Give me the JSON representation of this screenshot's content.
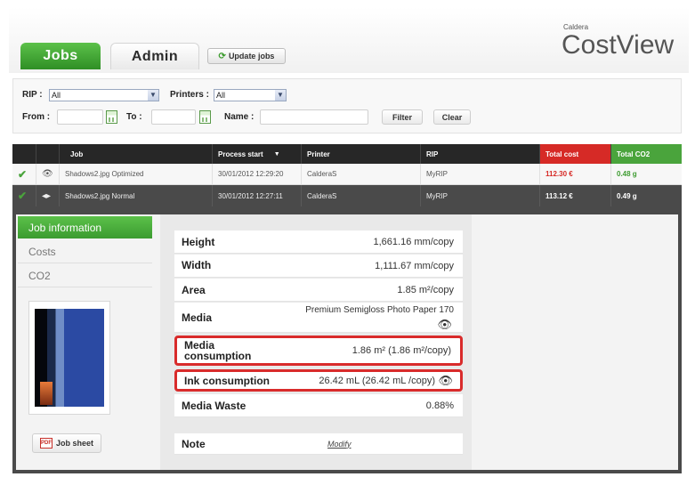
{
  "tabs": {
    "jobs": "Jobs",
    "admin": "Admin"
  },
  "update_jobs_label": "Update jobs",
  "brand": {
    "small": "Caldera",
    "big": "CostView"
  },
  "filters": {
    "rip_label": "RIP :",
    "rip_value": "All",
    "printers_label": "Printers :",
    "printers_value": "All",
    "from_label": "From :",
    "to_label": "To :",
    "name_label": "Name :",
    "filter_button": "Filter",
    "clear_button": "Clear"
  },
  "table": {
    "headers": {
      "job": "Job",
      "process_start": "Process start",
      "printer": "Printer",
      "rip": "RIP",
      "total_cost": "Total cost",
      "total_co2": "Total CO2"
    },
    "rows": [
      {
        "job": "Shadows2.jpg Optimized",
        "process_start": "30/01/2012 12:29:20",
        "printer": "CalderaS",
        "rip": "MyRIP",
        "total_cost": "112.30 €",
        "total_co2": "0.48 g"
      },
      {
        "job": "Shadows2.jpg Normal",
        "process_start": "30/01/2012 12:27:11",
        "printer": "CalderaS",
        "rip": "MyRIP",
        "total_cost": "113.12 €",
        "total_co2": "0.49 g"
      }
    ]
  },
  "side_nav": [
    "Job information",
    "Costs",
    "CO2"
  ],
  "job_sheet_label": "Job sheet",
  "pdf_badge": "PDF",
  "job_info": {
    "height": {
      "label": "Height",
      "value": "1,661.16 mm/copy"
    },
    "width": {
      "label": "Width",
      "value": "1,111.67 mm/copy"
    },
    "area": {
      "label": "Area",
      "value": "1.85 m²/copy"
    },
    "media": {
      "label": "Media",
      "value": "Premium Semigloss Photo Paper 170"
    },
    "media_consumption": {
      "label": "Media consumption",
      "value": "1.86 m² (1.86 m²/copy)"
    },
    "ink_consumption": {
      "label": "Ink consumption",
      "value": "26.42 mL (26.42 mL /copy)"
    },
    "media_waste": {
      "label": "Media Waste",
      "value": "0.88%"
    },
    "note": {
      "label": "Note",
      "modify": "Modify"
    }
  },
  "colors": {
    "accent_green": "#4aa43c",
    "cost_red": "#d62a26",
    "highlight_red": "#d92b2b"
  }
}
